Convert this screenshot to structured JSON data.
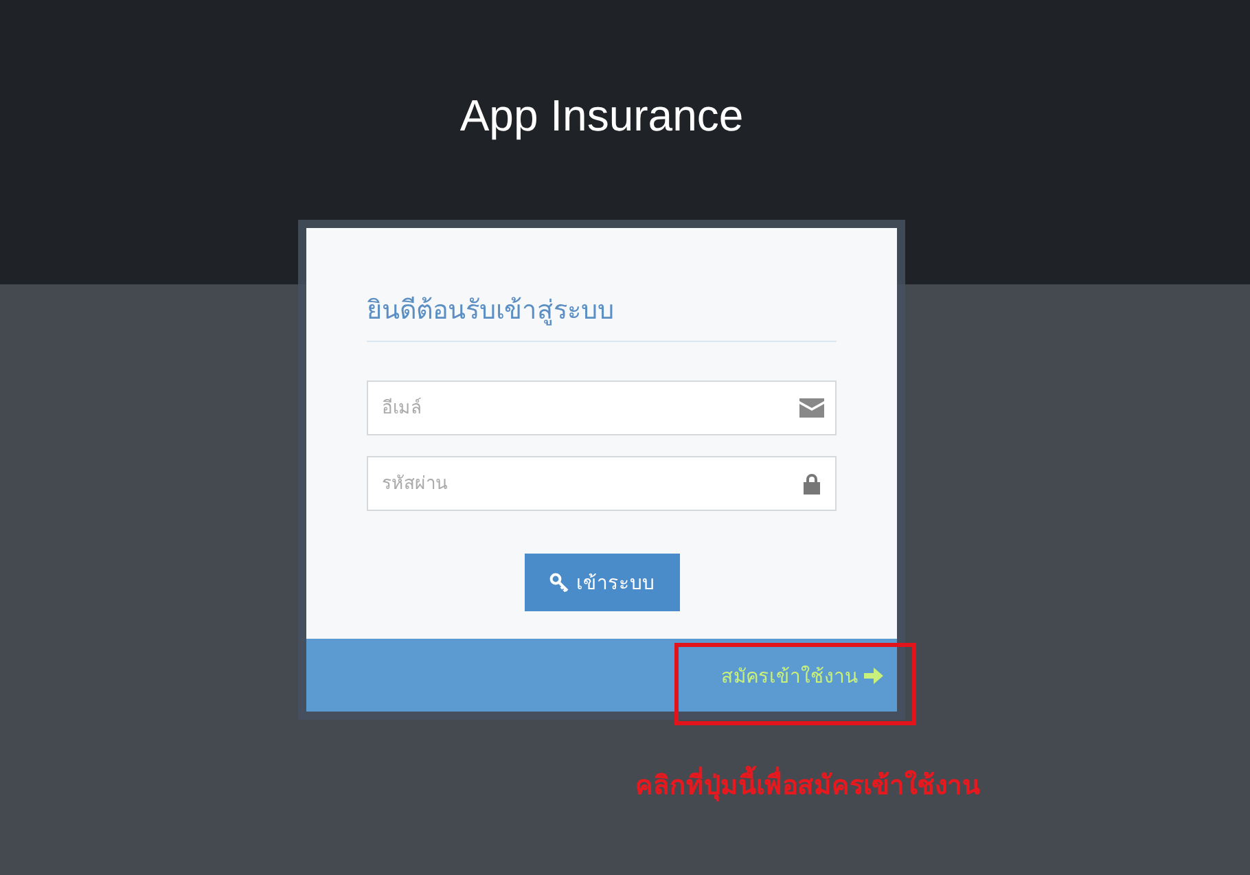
{
  "header": {
    "title": "App Insurance"
  },
  "login_card": {
    "heading": "ยินดีต้อนรับเข้าสู่ระบบ",
    "email_field": {
      "placeholder": "อีเมล์"
    },
    "password_field": {
      "placeholder": "รหัสผ่าน"
    },
    "login_button": "เข้าระบบ",
    "register_link": "สมัครเข้าใช้งาน"
  },
  "annotation": {
    "text": "คลิกที่ปุ่มนี้เพื่อสมัครเข้าใช้งาน"
  }
}
